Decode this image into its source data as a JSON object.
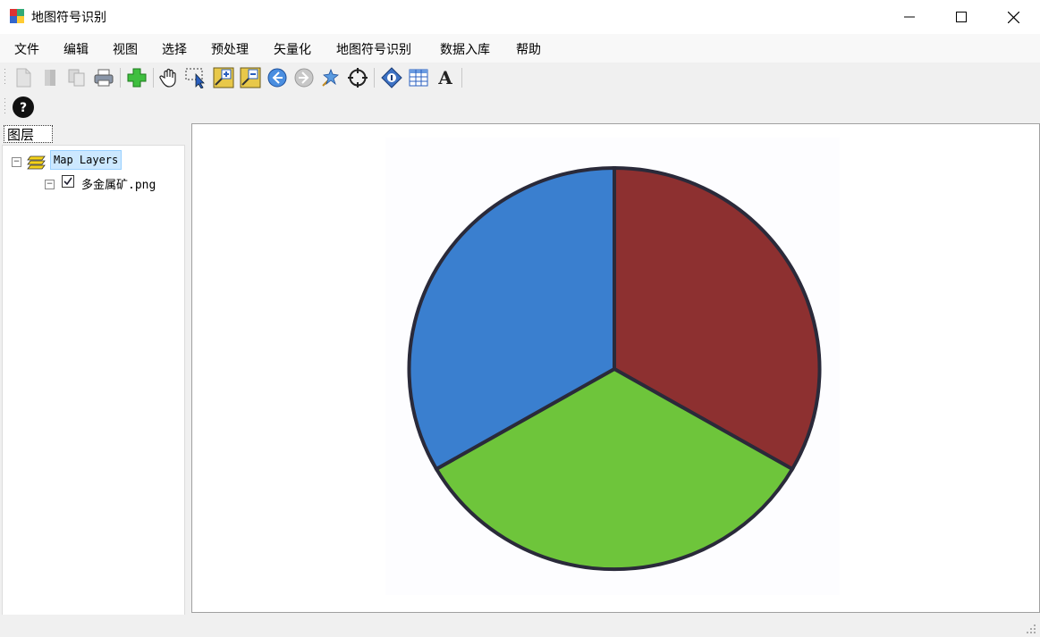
{
  "window": {
    "title": "地图符号识别"
  },
  "menu": [
    "文件",
    "编辑",
    "视图",
    "选择",
    "预处理",
    "矢量化",
    "地图符号识别",
    "数据入库",
    "帮助"
  ],
  "toolbar": {
    "icons": [
      "new-document-icon",
      "open-icon",
      "copy-icon",
      "print-icon",
      "add-data-icon",
      "pan-hand-icon",
      "select-features-icon",
      "zoom-in-icon",
      "zoom-out-icon",
      "back-extent-icon",
      "forward-extent-icon",
      "pointer-zoom-icon",
      "full-extent-icon",
      "identify-icon",
      "attribute-table-icon",
      "text-label-icon"
    ],
    "text_label": "A"
  },
  "toc": {
    "tab_label": "图层",
    "root_label": "Map Layers",
    "layer_label": "多金属矿.png",
    "layer_checked": true
  },
  "map_image": {
    "colors": {
      "blue": "#3a7fcf",
      "red": "#8d3030",
      "green": "#6ec53b",
      "outline": "#2a2a3a"
    }
  }
}
